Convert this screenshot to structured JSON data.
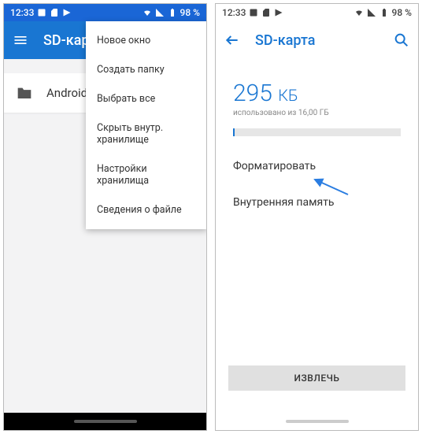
{
  "status": {
    "time": "12:33",
    "battery": "98 %"
  },
  "left": {
    "title": "SD-карта",
    "folder": "Android",
    "menu": [
      "Новое окно",
      "Создать папку",
      "Выбрать все",
      "Скрыть внутр. хранилище",
      "Настройки хранилища",
      "Сведения о файле"
    ]
  },
  "right": {
    "title": "SD-карта",
    "size_value": "295",
    "size_unit": "КБ",
    "sub": "использовано из 16,00 ГБ",
    "actions": [
      "Форматировать",
      "Внутренняя память"
    ],
    "eject": "ИЗВЛЕЧЬ"
  }
}
